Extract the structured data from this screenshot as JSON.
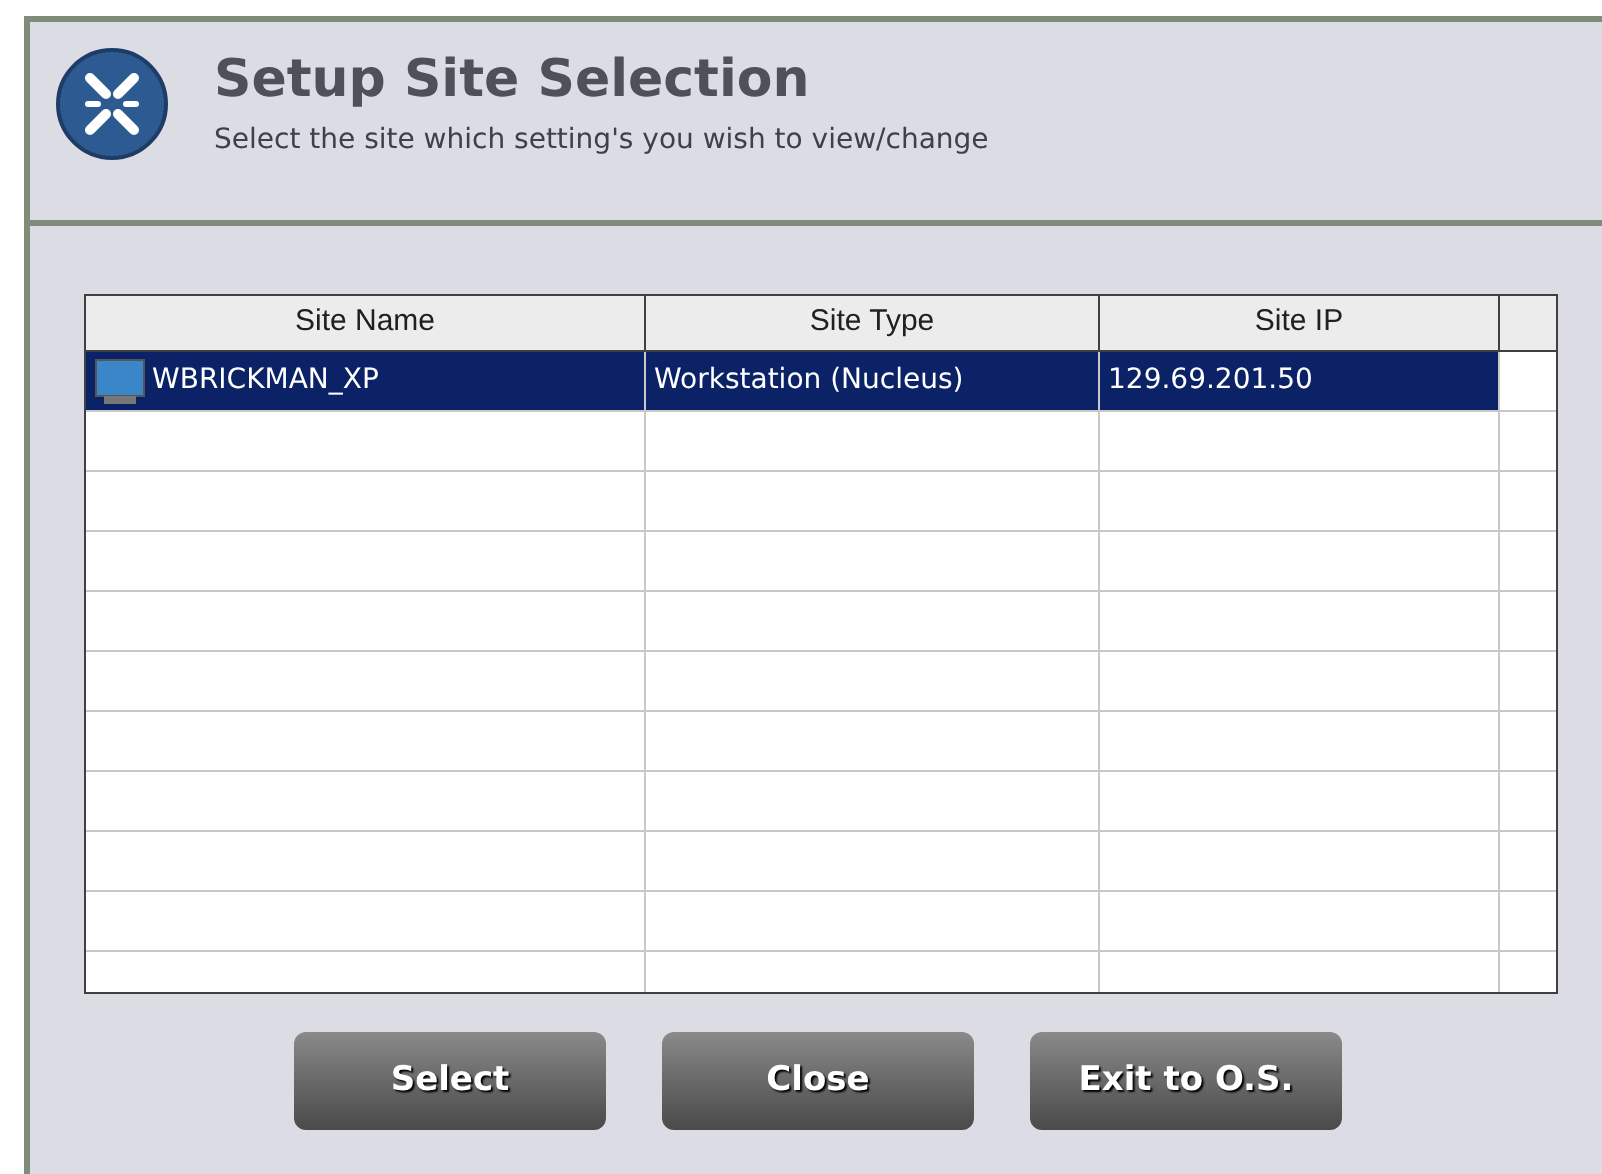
{
  "header": {
    "title": "Setup Site Selection",
    "subtitle": "Select the site which setting's you wish to view/change"
  },
  "table": {
    "columns": [
      "Site Name",
      "Site Type",
      "Site IP"
    ],
    "rows": [
      {
        "cells": [
          "WBRICKMAN_XP",
          "Workstation (Nucleus)",
          "129.69.201.50"
        ],
        "selected": true
      }
    ]
  },
  "buttons": [
    "Select",
    "Close",
    "Exit to O.S."
  ]
}
